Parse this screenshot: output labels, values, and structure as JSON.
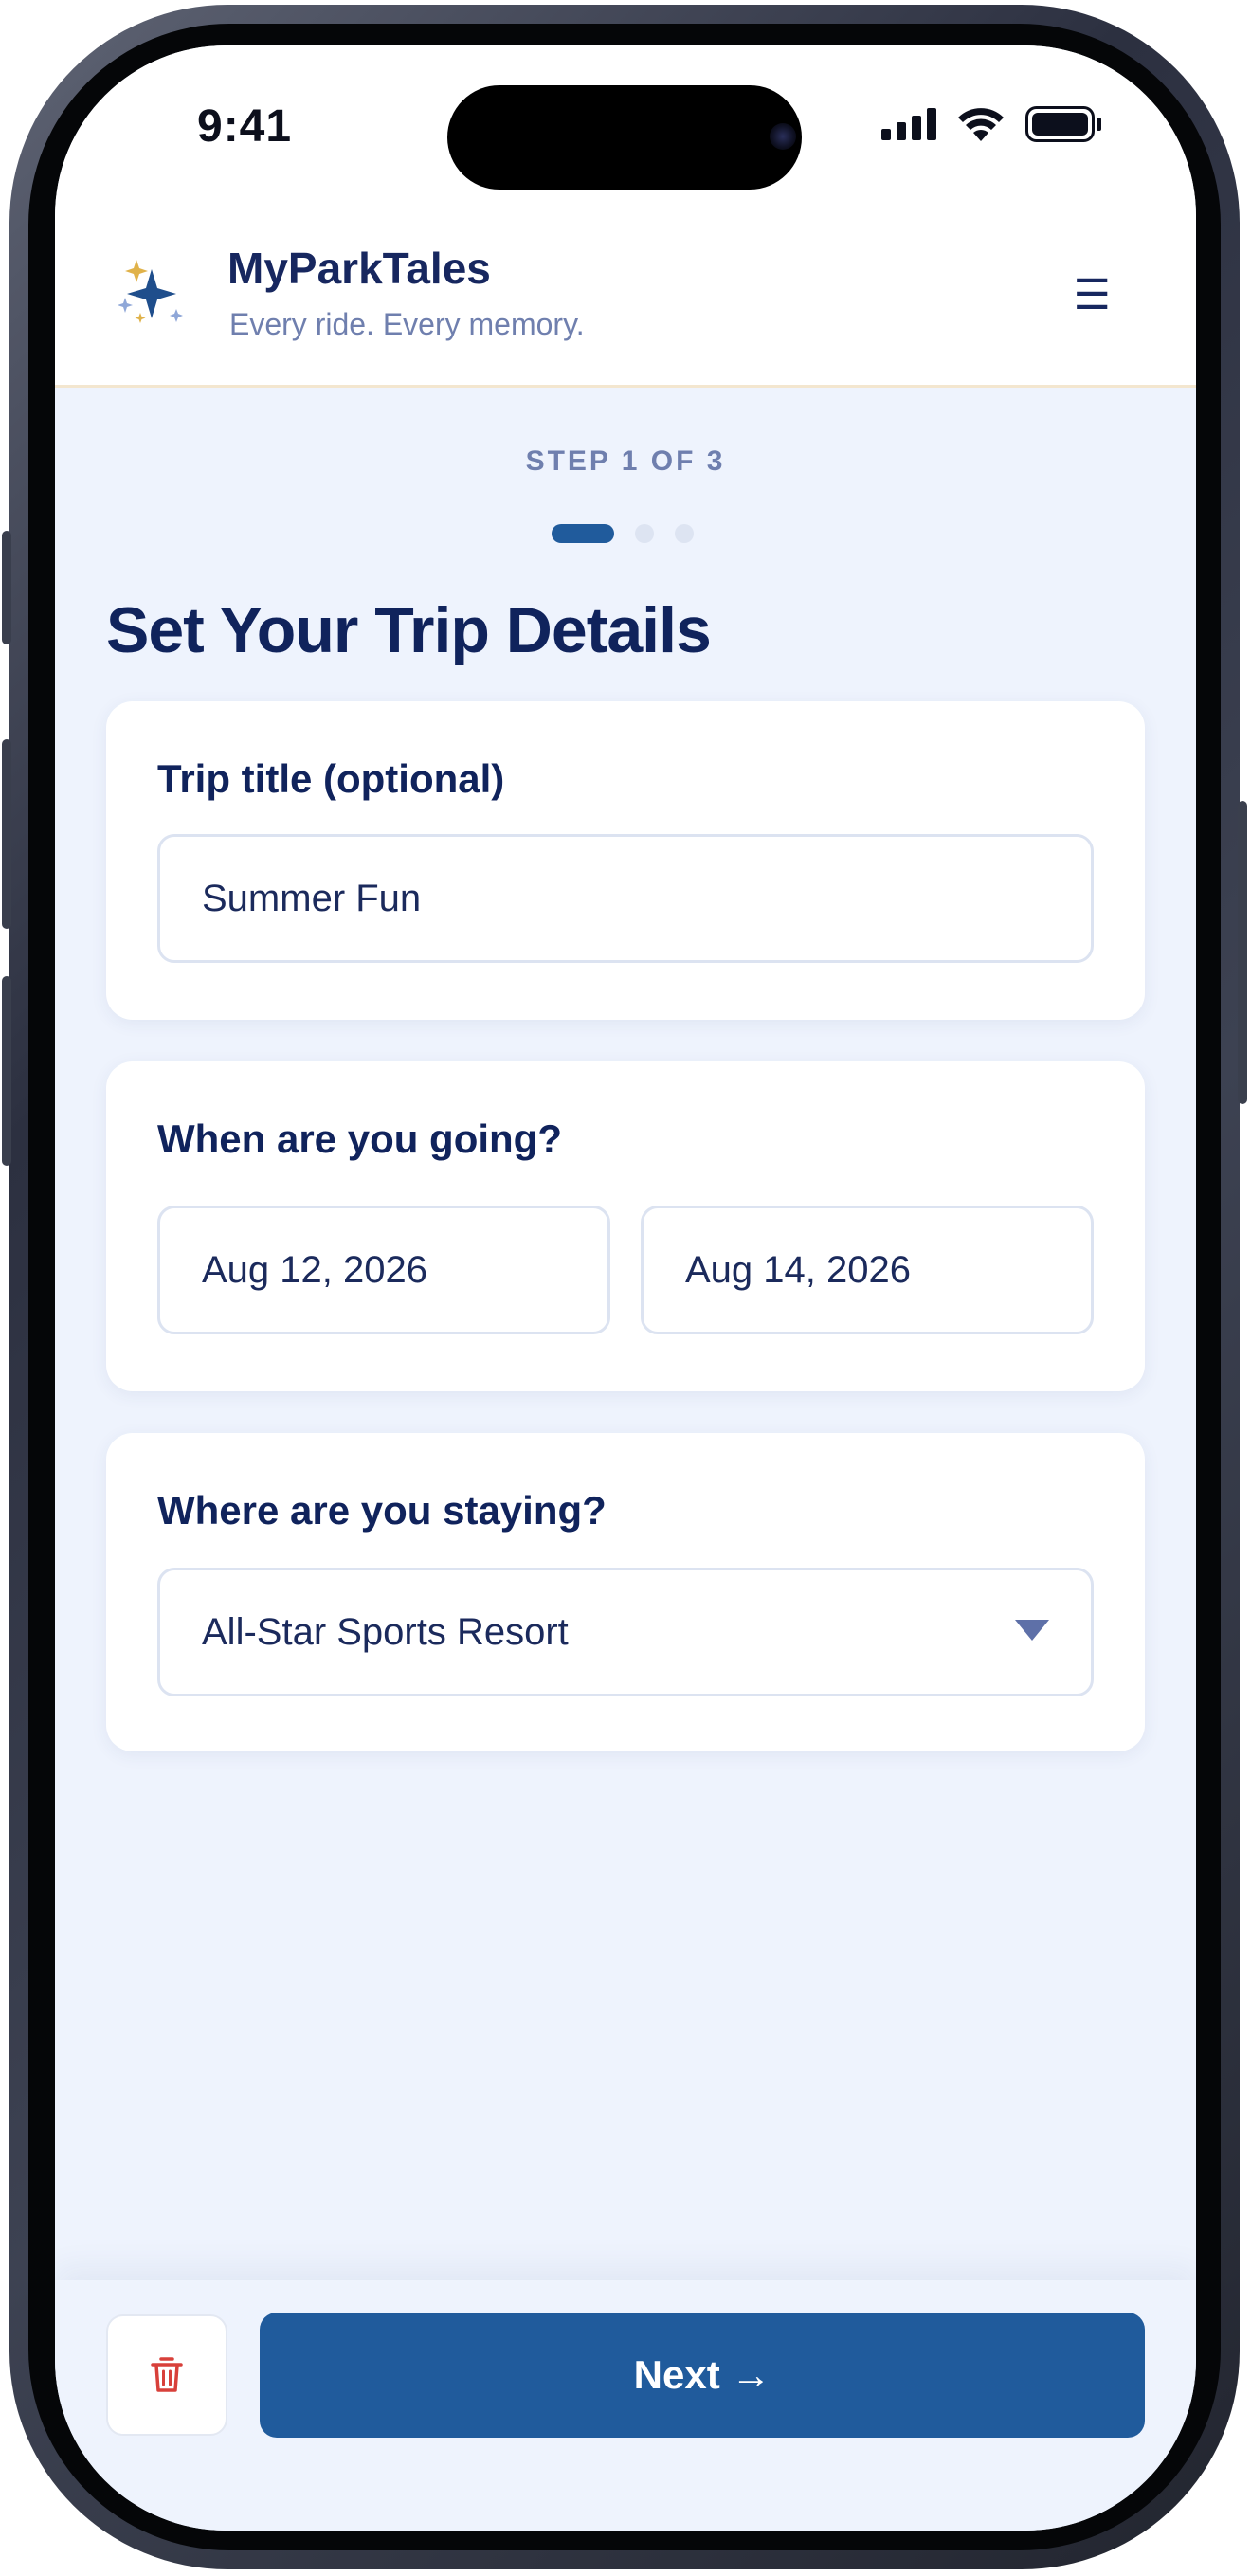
{
  "status_bar": {
    "time": "9:41"
  },
  "header": {
    "brand": "MyParkTales",
    "tagline": "Every ride. Every memory.",
    "menu_icon": "☰"
  },
  "progress": {
    "step_text": "STEP 1 OF 3",
    "current_step": 1,
    "total_steps": 3
  },
  "page": {
    "title": "Set Your Trip Details"
  },
  "trip_title": {
    "label": "Trip title (optional)",
    "value": "Summer Fun"
  },
  "dates": {
    "label": "When are you going?",
    "start": "Aug 12, 2026",
    "end": "Aug 14, 2026"
  },
  "stay": {
    "label": "Where are you staying?",
    "selected": "All-Star Sports Resort"
  },
  "footer": {
    "next_label": "Next →"
  },
  "colors": {
    "primary": "#205b9c",
    "heading": "#10235c",
    "background": "#eef3fd",
    "delete": "#d8403a",
    "star_gold": "#e0b24a"
  },
  "icons": [
    "sparkle-logo-icon",
    "signal-icon",
    "wifi-icon",
    "battery-icon",
    "menu-icon",
    "dropdown-caret-icon",
    "trash-icon"
  ]
}
